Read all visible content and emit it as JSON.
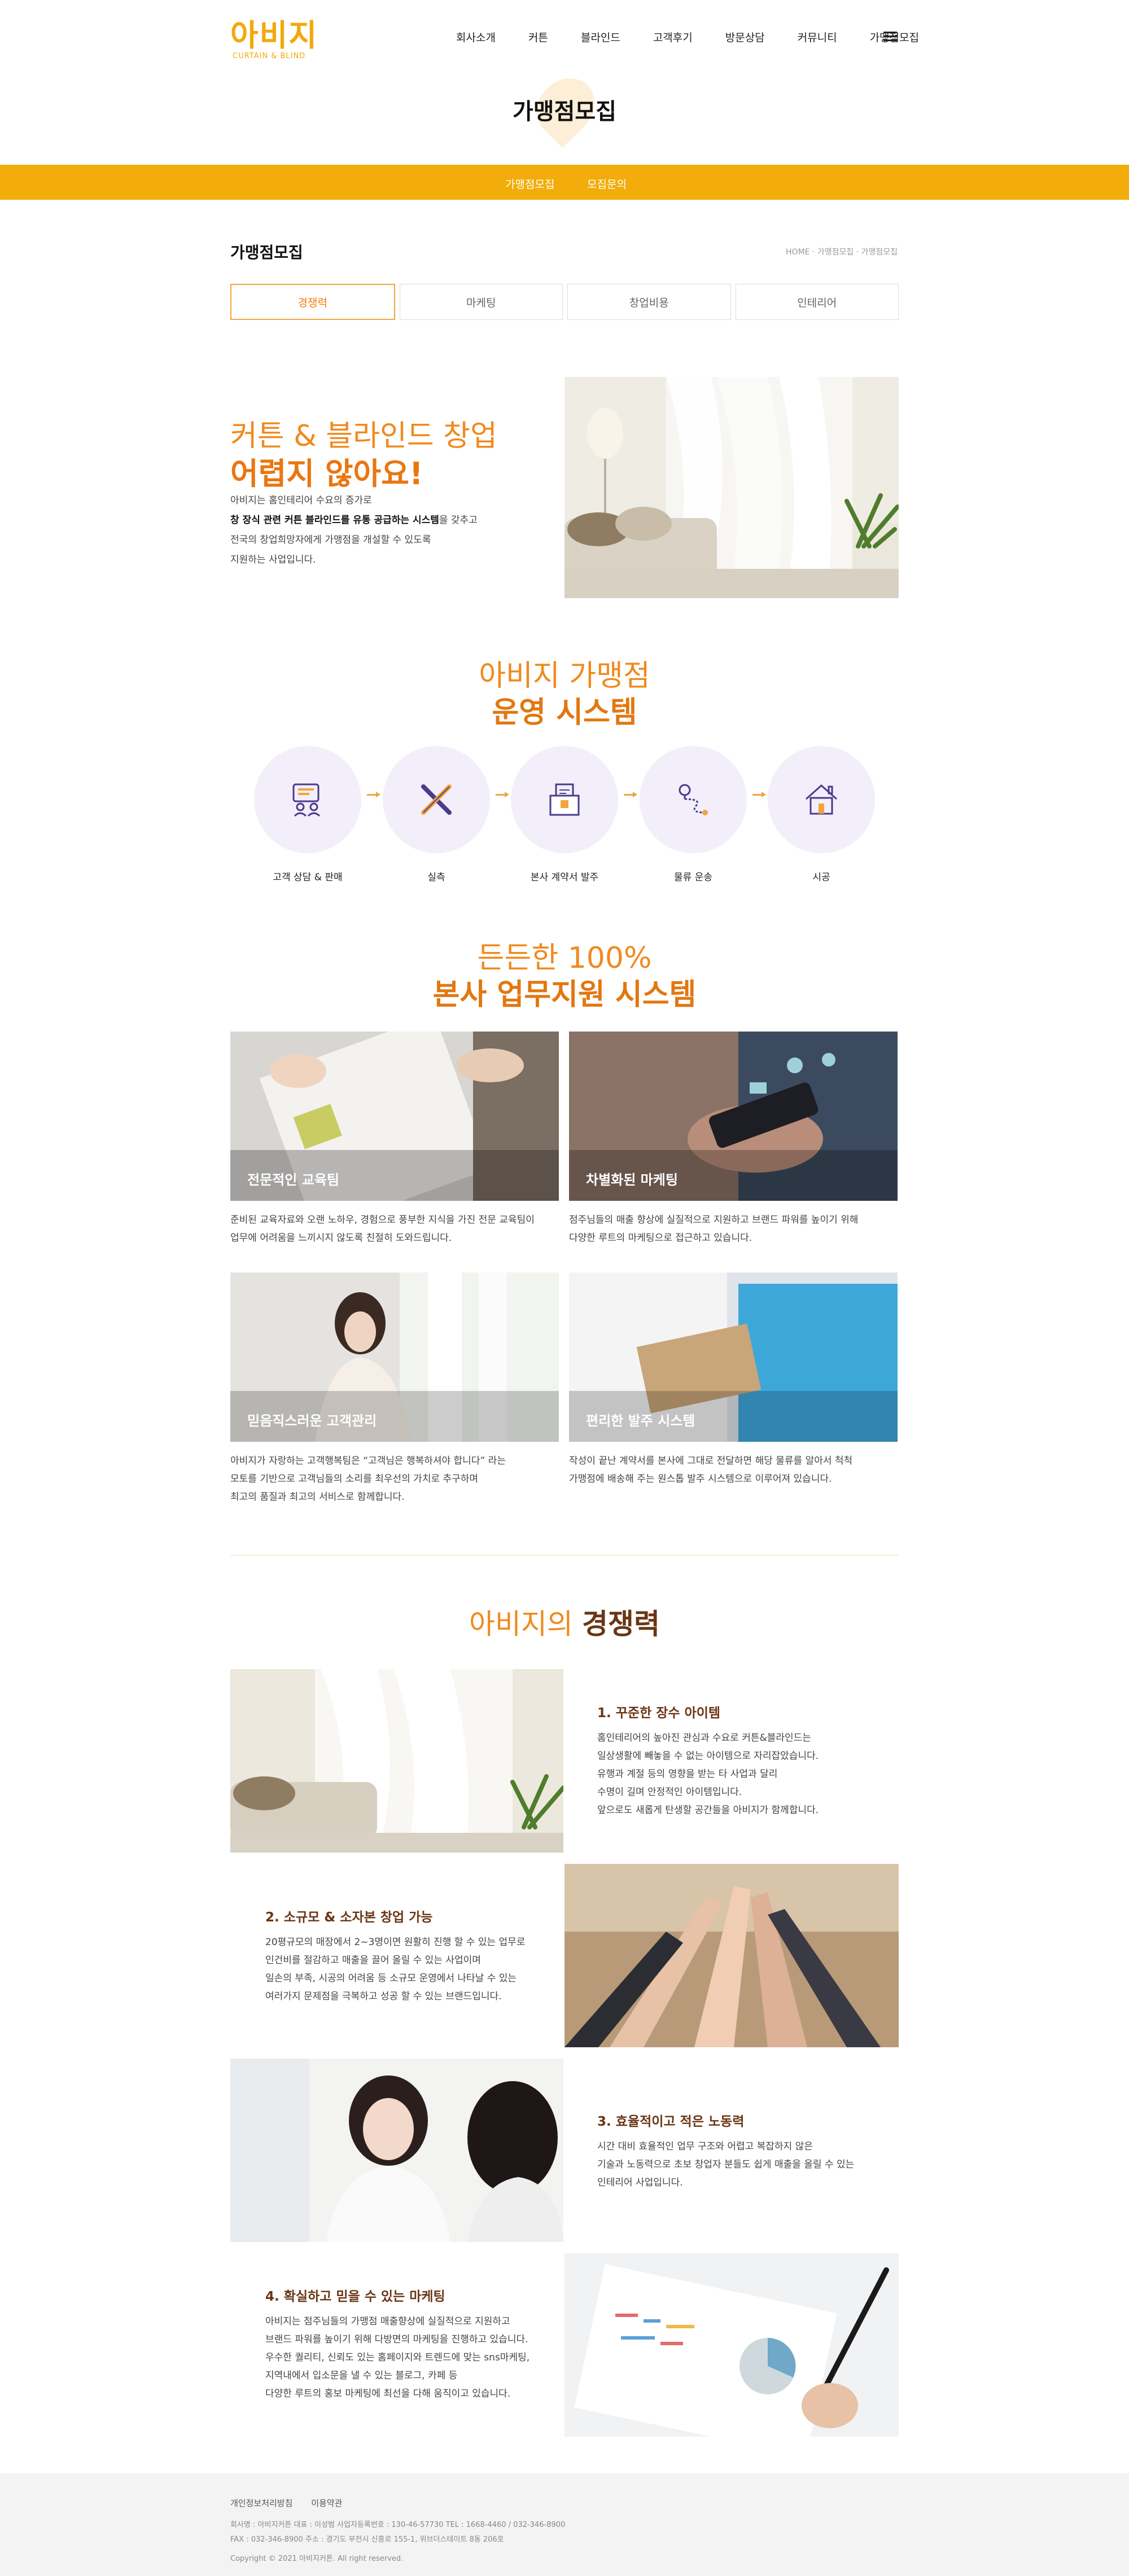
{
  "header": {
    "logo_text": "아비지",
    "logo_sub": "CURTAIN & BLIND",
    "nav": [
      "회사소개",
      "커튼",
      "블라인드",
      "고객후기",
      "방문상담",
      "커뮤니티",
      "가맹점모집"
    ]
  },
  "page_title": "가맹점모집",
  "subnav": [
    "가맹점모집",
    "모집문의"
  ],
  "section": {
    "title": "가맹점모집",
    "breadcrumb": "HOME · 가맹점모집 · 가맹점모집",
    "tabs": [
      "경쟁력",
      "마케팅",
      "창업비용",
      "인테리어"
    ],
    "active_tab": "경쟁력"
  },
  "hero": {
    "line1": "커튼 & 블라인드 창업",
    "line2": "어렵지 않아요!",
    "p1": "아비지는 홈인테리어 수요의 증가로",
    "p2_bold": "창 장식 관련 커튼 블라인드를 유통 공급하는 시스템",
    "p2_rest": "을 갖추고",
    "p3": "전국의 창업희망자에게 가맹점을 개설할 수 있도록",
    "p4": "지원하는 사업입니다."
  },
  "system": {
    "h1": "아비지 가맹점",
    "h2": "운영 시스템",
    "steps": [
      {
        "label": "고객 상담 & 판매",
        "icon": "consultation-icon"
      },
      {
        "label": "실측",
        "icon": "measure-tools-icon"
      },
      {
        "label": "본사 계약서 발주",
        "icon": "contract-box-icon"
      },
      {
        "label": "물류 운송",
        "icon": "delivery-route-icon"
      },
      {
        "label": "시공",
        "icon": "house-icon"
      }
    ]
  },
  "support": {
    "h1": "든든한 100%",
    "h2": "본사 업무지원 시스템",
    "cards": [
      {
        "caption": "전문적인 교육팀",
        "desc1": "준비된 교육자료와 오랜 노하우, 경험으로 풍부한 지식을 가진 전문 교육팀이",
        "desc2": "업무에 어려움을 느끼시지 않도록 친절히 도와드립니다.",
        "desc3": ""
      },
      {
        "caption": "차별화된 마케팅",
        "desc1": "점주님들의 매출 향상에 실질적으로 지원하고 브랜드 파워를 높이기 위해",
        "desc2": "다양한 루트의 마케팅으로 접근하고 있습니다.",
        "desc3": ""
      },
      {
        "caption": "믿음직스러운 고객관리",
        "desc1": "아비지가 자랑하는 고객행복팀은 “고객님은 행복하셔야 합니다” 라는",
        "desc2": "모토를 기반으로 고객님들의 소리를 최우선의 가치로 추구하며",
        "desc3": "최고의 품질과 최고의 서비스로 함께합니다."
      },
      {
        "caption": "편리한 발주 시스템",
        "desc1": "작성이 끝난 계약서를 본사에 그대로 전달하면 해당 물류를 알아서 척척",
        "desc2": "가맹점에 배송해 주는 원스톱 발주 시스템으로 이루어져 있습니다.",
        "desc3": ""
      }
    ]
  },
  "compet": {
    "title_normal": "아비지의 ",
    "title_bold": "경쟁력",
    "items": [
      {
        "heading": "1. 꾸준한 장수 아이템",
        "lines": [
          "홈인테리어의 높아진 관심과 수요로 커튼&블라인드는",
          "일상생활에 빼놓을 수 없는 아이템으로 자리잡았습니다.",
          "유행과 계절 등의 영향을 받는 타 사업과 달리",
          "수명이 길며 안정적인 아이템입니다.",
          "앞으로도 새롭게 탄생할 공간들을 아비지가 함께합니다."
        ]
      },
      {
        "heading": "2. 소규모 & 소자본 창업 가능",
        "lines": [
          "20평규모의 매장에서 2~3명이면 원활히 진행 할 수 있는 업무로",
          "인건비를 절감하고 매출을 끌어 올릴 수 있는 사업이며",
          "일손의 부족, 시공의 어려움 등 소규모 운영에서 나타날 수 있는",
          "여러가지 문제점을 극복하고 성공 할 수 있는 브랜드입니다."
        ]
      },
      {
        "heading": "3. 효율적이고 적은 노동력",
        "lines": [
          "시간 대비 효율적인 업무 구조와 어렵고 복잡하지 않은",
          "기술과 노동력으로 초보 창업자 분들도 쉽게 매출을 올릴 수 있는",
          "인테리어 사업입니다."
        ]
      },
      {
        "heading": "4. 확실하고 믿을 수 있는 마케팅",
        "lines": [
          "아비지는 점주님들의 가맹점 매출향상에 실질적으로 지원하고",
          "브랜드 파워를 높이기 위해 다방면의 마케팅을 진행하고 있습니다.",
          "우수한 퀄리티, 신뢰도 있는 홈페이지와 트렌드에 맞는 sns마케팅,",
          "지역내에서 입소문을 낼 수 있는 블로그, 카페 등",
          "다양한 루트의 홍보 마케팅에 최선을 다해 움직이고 있습니다."
        ]
      }
    ]
  },
  "footer": {
    "links": [
      "개인정보처리방침",
      "이용약관"
    ],
    "info1": "회사명 : 아비지커튼      대표 : 이성범      사업자등록번호 : 130-46-57730      TEL : 1668-4460 / 032-346-8900",
    "info2": "FAX : 032-346-8900      주소 : 경기도 부천시 신흥로 155-1, 위브더스테이트 8동 206호",
    "copyright": "Copyright © 2021 아비지커튼. All right reserved."
  },
  "colors": {
    "accent": "#f2ad0b",
    "orange": "#e27711",
    "brown": "#6a3515"
  }
}
